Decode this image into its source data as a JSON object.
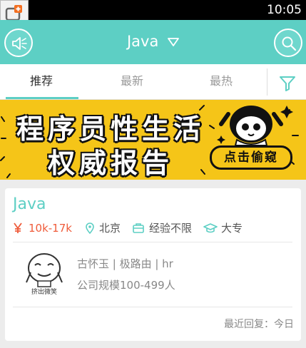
{
  "status_bar": {
    "time": "10:05"
  },
  "header": {
    "title": "Java",
    "title_dropdown_icon": "triangle-down-icon",
    "left_icon": "speaker-icon",
    "right_icon": "search-icon"
  },
  "tabs": [
    {
      "label": "推荐",
      "active": true
    },
    {
      "label": "最新",
      "active": false
    },
    {
      "label": "最热",
      "active": false
    }
  ],
  "filter_icon": "funnel-icon",
  "banner": {
    "line1": "程序员性生活",
    "line2": "权威报告",
    "button": "点击偷窥"
  },
  "job": {
    "title": "Java",
    "salary_icon": "yen-icon",
    "salary": "10k-17k",
    "location_icon": "location-pin-icon",
    "location": "北京",
    "experience_icon": "briefcase-icon",
    "experience": "经验不限",
    "education_icon": "graduation-cap-icon",
    "education": "大专",
    "avatar_caption": "挤出微笑",
    "poster": "古怀玉 | 极路由 | hr",
    "company_size": "公司规模100-499人",
    "last_reply": "最近回复：今日"
  },
  "colors": {
    "accent": "#5dcfc4",
    "salary": "#ef5b3a",
    "banner": "#f5c518"
  }
}
